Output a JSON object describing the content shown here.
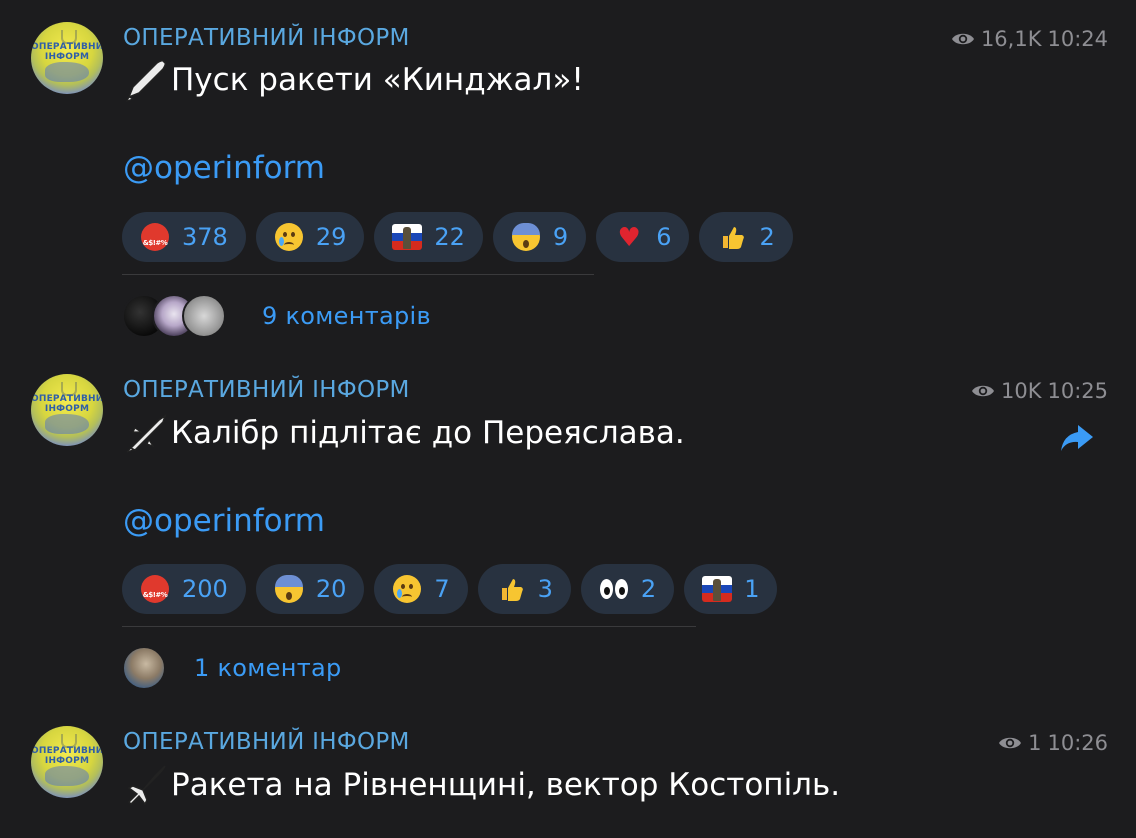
{
  "posts": [
    {
      "channel": "ОПЕРАТИВНИЙ ІНФОРМ",
      "avatar_text": "ОПЕРАТИВНИЙ ІНФОРМ",
      "views": "16,1K",
      "time": "10:24",
      "icon": "missile-icon",
      "text": "Пуск ракети «Кинджал»!",
      "mention": "@operinform",
      "reactions": [
        {
          "emoji": "angry-face-icon",
          "count": "378"
        },
        {
          "emoji": "crying-face-icon",
          "count": "29"
        },
        {
          "emoji": "russian-flag-figure-icon",
          "count": "22"
        },
        {
          "emoji": "screaming-face-icon",
          "count": "9"
        },
        {
          "emoji": "red-heart-icon",
          "count": "6"
        },
        {
          "emoji": "thumbs-up-icon",
          "count": "2"
        }
      ],
      "comments_label": "9 коментарів"
    },
    {
      "channel": "ОПЕРАТИВНИЙ ІНФОРМ",
      "avatar_text": "ОПЕРАТИВНИЙ ІНФОРМ",
      "views": "10K",
      "time": "10:25",
      "icon": "cruise-missile-icon",
      "text": "Калібр підлітає до Переяслава.",
      "mention": "@operinform",
      "reactions": [
        {
          "emoji": "angry-face-icon",
          "count": "200"
        },
        {
          "emoji": "screaming-face-icon",
          "count": "20"
        },
        {
          "emoji": "crying-face-icon",
          "count": "7"
        },
        {
          "emoji": "thumbs-up-icon",
          "count": "3"
        },
        {
          "emoji": "eyes-icon",
          "count": "2"
        },
        {
          "emoji": "russian-flag-figure-icon",
          "count": "1"
        }
      ],
      "comments_label": "1 коментар"
    },
    {
      "channel": "ОПЕРАТИВНИЙ ІНФОРМ",
      "avatar_text": "ОПЕРАТИВНИЙ ІНФОРМ",
      "views": "1",
      "time": "10:26",
      "icon": "airplane-icon",
      "text": "Ракета на Рівненщині, вектор Костопіль."
    }
  ],
  "colors": {
    "background": "#1c1c1e",
    "channel_name": "#5aa8e0",
    "link": "#3b9bf5",
    "reaction_bg": "#283240",
    "meta": "#8e8e93"
  }
}
